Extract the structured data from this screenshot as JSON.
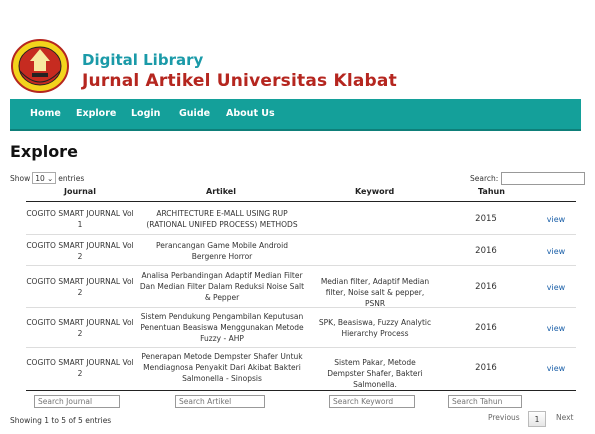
{
  "header": {
    "title": "Digital Library",
    "subtitle": "Jurnal Artikel Universitas Klabat",
    "logo_icon": "university-seal"
  },
  "nav": {
    "home": "Home",
    "explore": "Explore",
    "login": "Login",
    "guide": "Guide",
    "about": "About Us"
  },
  "page": {
    "title": "Explore"
  },
  "controls": {
    "show_label": "Show",
    "entries_value": "10",
    "entries_label": "entries",
    "search_label": "Search:"
  },
  "table": {
    "columns": [
      "Journal",
      "Artikel",
      "Keyword",
      "Tahun"
    ],
    "rows": [
      {
        "journal": "COGITO SMART JOURNAL Vol 1",
        "artikel": "ARCHITECTURE E-MALL USING RUP (RATIONAL UNIFED PROCESS) METHODS",
        "keyword": "",
        "tahun": "2015",
        "action": "view"
      },
      {
        "journal": "COGITO SMART JOURNAL Vol 2",
        "artikel": "Perancangan Game Mobile Android Bergenre Horror",
        "keyword": "",
        "tahun": "2016",
        "action": "view"
      },
      {
        "journal": "COGITO SMART JOURNAL Vol 2",
        "artikel": "Analisa Perbandingan Adaptif Median Filter Dan Median Filter Dalam Reduksi Noise Salt & Pepper",
        "keyword": "Median filter, Adaptif Median filter, Noise salt & pepper, PSNR",
        "tahun": "2016",
        "action": "view"
      },
      {
        "journal": "COGITO SMART JOURNAL Vol 2",
        "artikel": "Sistem Pendukung Pengambilan Keputusan Penentuan Beasiswa Menggunakan Metode Fuzzy - AHP",
        "keyword": "SPK, Beasiswa, Fuzzy Analytic Hierarchy Process",
        "tahun": "2016",
        "action": "view"
      },
      {
        "journal": "COGITO SMART JOURNAL Vol 2",
        "artikel": "Penerapan Metode Dempster Shafer Untuk Mendiagnosa Penyakit Dari Akibat Bakteri Salmonella - Sinopsis",
        "keyword": "Sistem Pakar, Metode Dempster Shafer, Bakteri Salmonella.",
        "tahun": "2016",
        "action": "view"
      }
    ]
  },
  "filters": {
    "journal": "Search Journal",
    "artikel": "Search Artikel",
    "keyword": "Search Keyword",
    "tahun": "Search Tahun"
  },
  "footer": {
    "info": "Showing 1 to 5 of 5 entries",
    "previous": "Previous",
    "page": "1",
    "next": "Next"
  }
}
